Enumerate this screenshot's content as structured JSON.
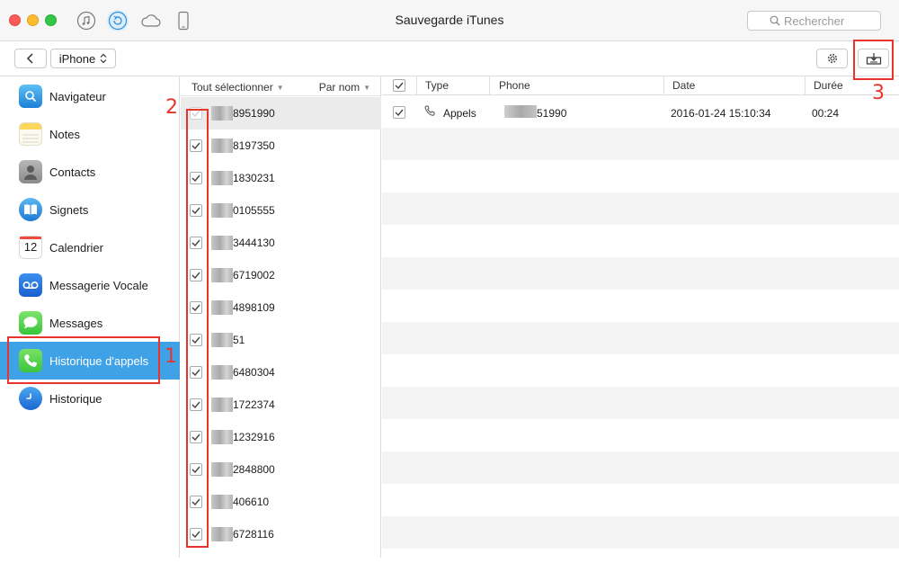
{
  "window": {
    "title": "Sauvegarde iTunes",
    "search_placeholder": "Rechercher",
    "mode_icons": [
      "music-icon",
      "sync-icon",
      "cloud-icon",
      "phone-icon"
    ]
  },
  "toolbar": {
    "device": "iPhone"
  },
  "sidebar": {
    "items": [
      {
        "label": "Navigateur",
        "icon": "safari-icon"
      },
      {
        "label": "Notes",
        "icon": "notes-icon"
      },
      {
        "label": "Contacts",
        "icon": "contacts-icon"
      },
      {
        "label": "Signets",
        "icon": "bookmarks-icon"
      },
      {
        "label": "Calendrier",
        "icon": "calendar-icon",
        "icon_text": "12"
      },
      {
        "label": "Messagerie Vocale",
        "icon": "voicemail-icon"
      },
      {
        "label": "Messages",
        "icon": "messages-icon"
      },
      {
        "label": "Historique d'appels",
        "icon": "phone-icon",
        "active": true
      },
      {
        "label": "Historique",
        "icon": "clock-icon"
      }
    ]
  },
  "contacts": {
    "select_all": "Tout sélectionner",
    "sort": "Par nom",
    "rows": [
      "8951990",
      "8197350",
      "1830231",
      "0105555",
      "3444130",
      "6719002",
      "4898109",
      "51",
      "6480304",
      "1722374",
      "1232916",
      "2848800",
      "406610",
      "6728116"
    ]
  },
  "detail": {
    "columns": {
      "type": "Type",
      "phone": "Phone",
      "date": "Date",
      "duration": "Durée"
    },
    "rows": [
      {
        "type": "Appels",
        "phone": "51990",
        "date": "2016-01-24 15:10:34",
        "duration": "00:24"
      }
    ]
  },
  "annotations": {
    "one": "1",
    "two": "2",
    "three": "3"
  },
  "colors": {
    "accent": "#3fa2e6",
    "annotation": "#e8352b"
  }
}
